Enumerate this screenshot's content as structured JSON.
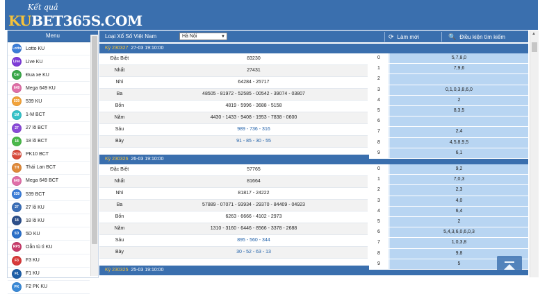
{
  "header": {
    "logo_tagline": "Kết quả",
    "logo_ku": "KU",
    "logo_rest": "BET365S.COM"
  },
  "sidebar": {
    "title": "Menu",
    "items": [
      {
        "label": "Lotto KU",
        "badge": "Lotto",
        "color": "#3b7dd8"
      },
      {
        "label": "Live KU",
        "badge": "Live",
        "color": "#7d3bd8"
      },
      {
        "label": "Đua xe KU",
        "badge": "Car",
        "color": "#3ba84a"
      },
      {
        "label": "Mega 649 KU",
        "badge": "649",
        "color": "#e06fa8"
      },
      {
        "label": "539 KU",
        "badge": "539",
        "color": "#f2a33a"
      },
      {
        "label": "1-M BCT",
        "badge": "1M",
        "color": "#36c2c8"
      },
      {
        "label": "27 lô BCT",
        "badge": "27",
        "color": "#8a4ad8"
      },
      {
        "label": "18 lô BCT",
        "badge": "18",
        "color": "#4ab84a"
      },
      {
        "label": "PK10 BCT",
        "badge": "PK10",
        "color": "#d84a3a"
      },
      {
        "label": "Thái Lan BCT",
        "badge": "TH",
        "color": "#e08a3a"
      },
      {
        "label": "Mega 649 BCT",
        "badge": "649",
        "color": "#e06fa8"
      },
      {
        "label": "539 BCT",
        "badge": "539",
        "color": "#3b7dd8"
      },
      {
        "label": "27 lô KU",
        "badge": "27",
        "color": "#3b6fb8"
      },
      {
        "label": "18 lô KU",
        "badge": "18",
        "color": "#2c4f8a"
      },
      {
        "label": "5D KU",
        "badge": "5D",
        "color": "#2a6fc8"
      },
      {
        "label": "Oẳn tù tì KU",
        "badge": "RPS",
        "color": "#c83a6a"
      },
      {
        "label": "F3 KU",
        "badge": "F3",
        "color": "#d83a3a"
      },
      {
        "label": "F1 KU",
        "badge": "F1",
        "color": "#1e5fa8"
      },
      {
        "label": "F2 PK KU",
        "badge": "PK",
        "color": "#3a8ad8"
      }
    ]
  },
  "toolbar": {
    "label": "Loại Xổ Số Việt Nam",
    "select_value": "Hà Nội",
    "refresh_label": "Làm mới",
    "search_label": "Điều kiện tìm kiếm"
  },
  "draws": [
    {
      "ky": "Kỳ 230327",
      "datetime": "27-03 19:10:00",
      "prizes": [
        {
          "name": "Đặc Biệt",
          "value": "83230"
        },
        {
          "name": "Nhất",
          "value": "27431"
        },
        {
          "name": "Nhì",
          "value": "64284 - 25717"
        },
        {
          "name": "Ba",
          "value": "48505 - 81972 - 52585 - 00542 - 39074 - 03807"
        },
        {
          "name": "Bốn",
          "value": "4819 - 5996 - 3688 - 5158"
        },
        {
          "name": "Năm",
          "value": "4430 - 1433 - 9408 - 1953 - 7838 - 0600"
        },
        {
          "name": "Sáu",
          "value": "989 - 736 - 316"
        },
        {
          "name": "Bảy",
          "value": "91 - 85 - 30 - 55"
        }
      ],
      "loto": [
        {
          "head": "0",
          "tail": "5,7,8,0"
        },
        {
          "head": "1",
          "tail": "7,9,6"
        },
        {
          "head": "2",
          "tail": ""
        },
        {
          "head": "3",
          "tail": "0,1,0,3,8,6,0"
        },
        {
          "head": "4",
          "tail": "2"
        },
        {
          "head": "5",
          "tail": "8,3,5"
        },
        {
          "head": "6",
          "tail": ""
        },
        {
          "head": "7",
          "tail": "2,4"
        },
        {
          "head": "8",
          "tail": "4,5,8,9,5"
        },
        {
          "head": "9",
          "tail": "6,1"
        }
      ]
    },
    {
      "ky": "Kỳ 230326",
      "datetime": "26-03 19:10:00",
      "prizes": [
        {
          "name": "Đặc Biệt",
          "value": "57765"
        },
        {
          "name": "Nhất",
          "value": "81664"
        },
        {
          "name": "Nhì",
          "value": "81817 - 24222"
        },
        {
          "name": "Ba",
          "value": "57889 - 07071 - 93934 - 29370 - 84409 - 04923"
        },
        {
          "name": "Bốn",
          "value": "6263 - 6666 - 4102 - 2973"
        },
        {
          "name": "Năm",
          "value": "1310 - 3160 - 6446 - 8566 - 3378 - 2688"
        },
        {
          "name": "Sáu",
          "value": "895 - 560 - 344"
        },
        {
          "name": "Bảy",
          "value": "30 - 52 - 63 - 13"
        }
      ],
      "loto": [
        {
          "head": "0",
          "tail": "9,2"
        },
        {
          "head": "1",
          "tail": "7,0,3"
        },
        {
          "head": "2",
          "tail": "2,3"
        },
        {
          "head": "3",
          "tail": "4,0"
        },
        {
          "head": "4",
          "tail": "6,4"
        },
        {
          "head": "5",
          "tail": "2"
        },
        {
          "head": "6",
          "tail": "5,4,3,6,0,6,0,3"
        },
        {
          "head": "7",
          "tail": "1,0,3,8"
        },
        {
          "head": "8",
          "tail": "9,8"
        },
        {
          "head": "9",
          "tail": "5"
        }
      ]
    },
    {
      "ky": "Kỳ 230325",
      "datetime": "25-03 19:10:00",
      "prizes": [],
      "loto": []
    }
  ],
  "colors": {
    "header_blue": "#3a6fae",
    "accent_yellow": "#f6c33a",
    "loto_blue": "#b8d5f2",
    "number_blue": "#1e5fa8"
  }
}
